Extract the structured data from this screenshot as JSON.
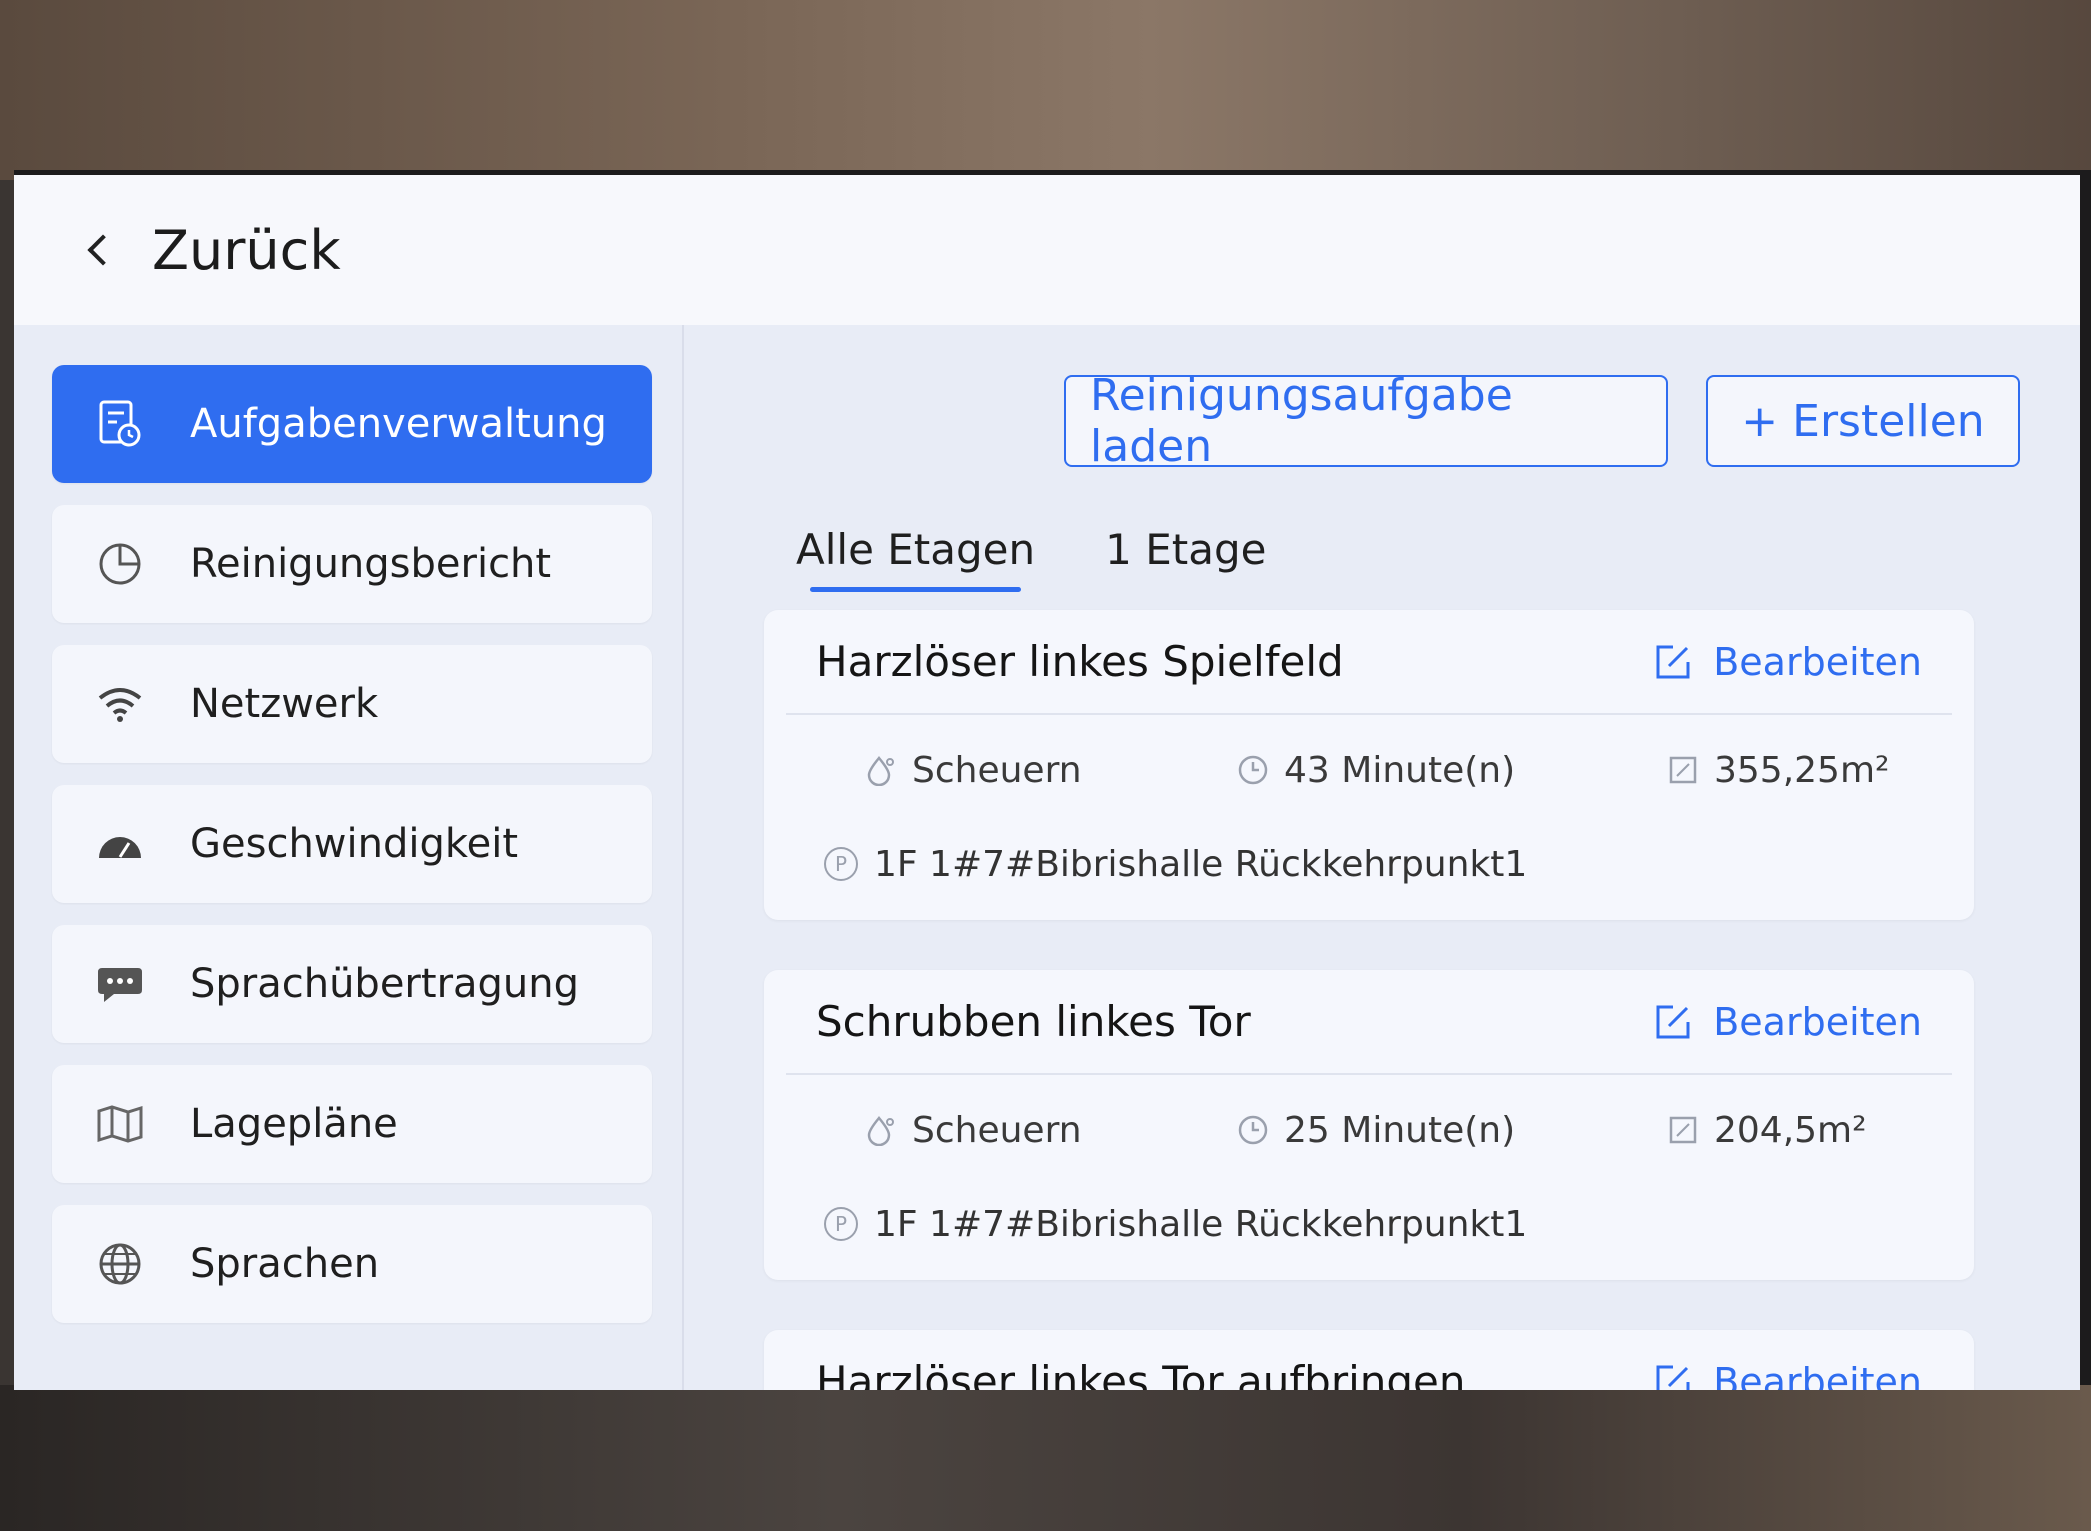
{
  "header": {
    "back_label": "Zurück"
  },
  "sidebar": {
    "items": [
      {
        "label": "Aufgabenverwaltung",
        "icon": "task-icon",
        "active": true
      },
      {
        "label": "Reinigungsbericht",
        "icon": "pie-chart-icon"
      },
      {
        "label": "Netzwerk",
        "icon": "wifi-icon"
      },
      {
        "label": "Geschwindigkeit",
        "icon": "speedometer-icon"
      },
      {
        "label": "Sprachübertragung",
        "icon": "chat-icon"
      },
      {
        "label": "Lagepläne",
        "icon": "map-icon"
      },
      {
        "label": "Sprachen",
        "icon": "globe-icon"
      }
    ]
  },
  "toolbar": {
    "load_label": "Reinigungsaufgabe laden",
    "create_label": "+ Erstellen"
  },
  "tabs": [
    {
      "label": "Alle Etagen",
      "active": true
    },
    {
      "label": "1 Etage"
    }
  ],
  "tasks": [
    {
      "title": "Harzlöser linkes Spielfeld",
      "edit_label": "Bearbeiten",
      "mode": "Scheuern",
      "duration": "43 Minute(n)",
      "area": "355,25m²",
      "point": "1F 1#7#Bibrishalle Rückkehrpunkt1"
    },
    {
      "title": "Schrubben linkes Tor",
      "edit_label": "Bearbeiten",
      "mode": "Scheuern",
      "duration": "25 Minute(n)",
      "area": "204,5m²",
      "point": "1F 1#7#Bibrishalle Rückkehrpunkt1"
    },
    {
      "title": "Harzlöser linkes Tor aufbringen",
      "edit_label": "Bearbeiten"
    }
  ],
  "colors": {
    "accent": "#2f6df0",
    "text": "#1f1f1f",
    "surface": "#f5f7fd"
  }
}
